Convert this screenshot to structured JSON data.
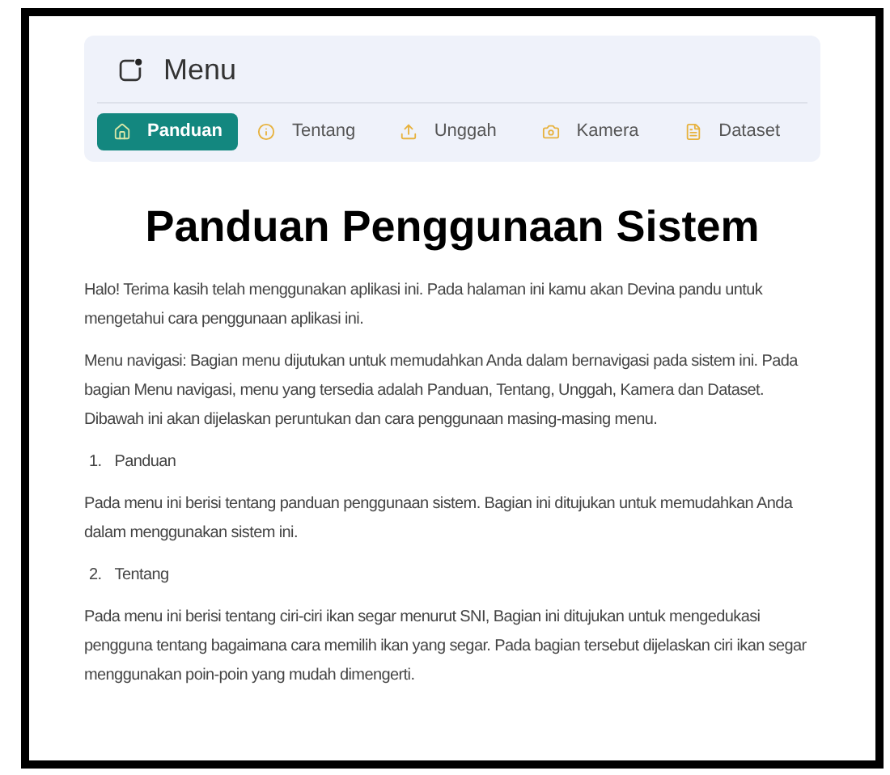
{
  "menu": {
    "title": "Menu",
    "tabs": [
      {
        "label": "Panduan",
        "kind": "home",
        "selected": true
      },
      {
        "label": "Tentang",
        "kind": "info",
        "selected": false
      },
      {
        "label": "Unggah",
        "kind": "upload",
        "selected": false
      },
      {
        "label": "Kamera",
        "kind": "camera",
        "selected": false
      },
      {
        "label": "Dataset",
        "kind": "file",
        "selected": false
      }
    ]
  },
  "heading": "Panduan Penggunaan Sistem",
  "blocks": [
    {
      "kind": "paragraph",
      "text": "Halo! Terima kasih telah menggunakan aplikasi ini. Pada halaman ini kamu akan Devina pandu untuk mengetahui cara penggunaan aplikasi ini."
    },
    {
      "kind": "paragraph",
      "text": "Menu navigasi: Bagian menu dijutukan untuk memudahkan Anda dalam bernavigasi pada sistem ini. Pada bagian Menu navigasi, menu yang tersedia adalah Panduan, Tentang, Unggah, Kamera dan Dataset. Dibawah ini akan dijelaskan peruntukan dan cara penggunaan masing-masing menu."
    },
    {
      "kind": "list_item",
      "number": "1.",
      "text": "Panduan"
    },
    {
      "kind": "paragraph",
      "text": "Pada menu ini berisi tentang panduan penggunaan sistem. Bagian ini ditujukan untuk memudahkan Anda dalam menggunakan sistem ini."
    },
    {
      "kind": "list_item",
      "number": "2.",
      "text": "Tentang"
    },
    {
      "kind": "paragraph",
      "text": "Pada menu ini berisi tentang ciri-ciri ikan segar menurut SNI, Bagian ini ditujukan untuk mengedukasi pengguna tentang bagaimana cara memilih ikan yang segar. Pada bagian tersebut dijelaskan ciri ikan segar menggunakan poin-poin yang mudah dimengerti."
    }
  ]
}
